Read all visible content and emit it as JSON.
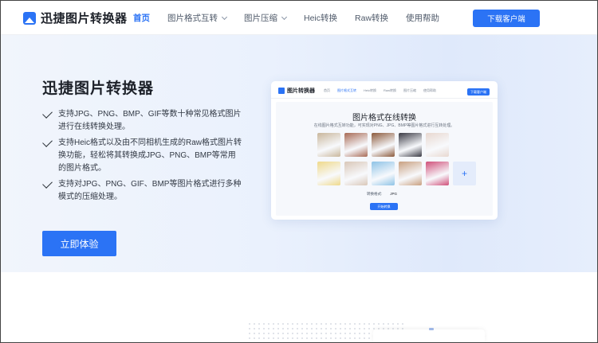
{
  "header": {
    "logo_text": "迅捷图片转换器",
    "nav": [
      {
        "label": "首页",
        "active": true,
        "dropdown": false
      },
      {
        "label": "图片格式互转",
        "active": false,
        "dropdown": true
      },
      {
        "label": "图片压缩",
        "active": false,
        "dropdown": true
      },
      {
        "label": "Heic转换",
        "active": false,
        "dropdown": false
      },
      {
        "label": "Raw转换",
        "active": false,
        "dropdown": false
      },
      {
        "label": "使用帮助",
        "active": false,
        "dropdown": false
      }
    ],
    "download_label": "下载客户端"
  },
  "hero": {
    "title": "迅捷图片转换器",
    "features": [
      "支持JPG、PNG、BMP、GIF等数十种常见格式图片进行在线转换处理。",
      "支持Heic格式以及由不同相机生成的Raw格式图片转换功能，轻松将其转换成JPG、PNG、BMP等常用的图片格式。",
      "支持对JPG、PNG、GIF、BMP等图片格式进行多种模式的压缩处理。"
    ],
    "cta_label": "立即体验"
  },
  "preview": {
    "logo_text": "图片转换器",
    "nav": [
      "首页",
      "图片格式互转",
      "Heic转换",
      "Raw转换",
      "图片压缩",
      "使用帮助"
    ],
    "download_label": "下载客户端",
    "title": "图片格式在线转换",
    "subtitle": "在线图片格式互转功能，可实现对PNG、JPG、BMP等图片格式进行互转处理。",
    "format_label": "转换格式:",
    "format_value": "JPG",
    "start_label": "开始转换",
    "add_icon": "+",
    "thumb_colors": [
      "#c9b79c",
      "#a86a55",
      "#8c5a3c",
      "#3a3a44",
      "#e8d8d0",
      "#efd98a",
      "#d9c7b8",
      "#8ec3e6",
      "#c9a080",
      "#d0507a"
    ]
  },
  "colors": {
    "accent": "#2b73f5",
    "text": "#1d2129"
  }
}
